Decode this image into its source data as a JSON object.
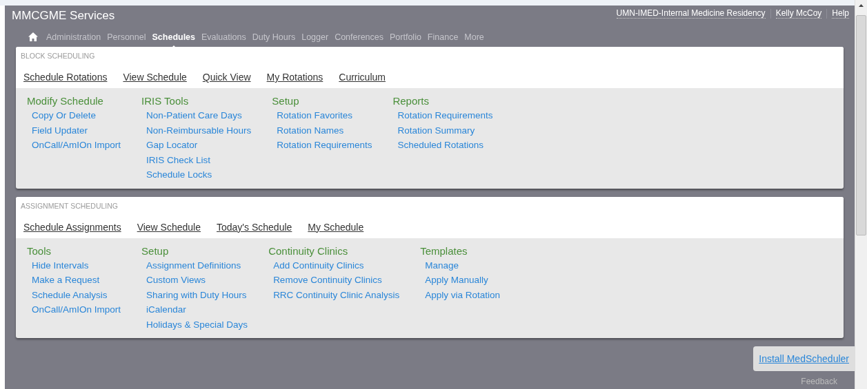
{
  "app_title": "MMCGME Services",
  "header_links": [
    "UMN-IMED-Internal Medicine Residency",
    "Kelly McCoy",
    "Help"
  ],
  "nav": [
    {
      "label": "Administration",
      "selected": false
    },
    {
      "label": "Personnel",
      "selected": false
    },
    {
      "label": "Schedules",
      "selected": true
    },
    {
      "label": "Evaluations",
      "selected": false
    },
    {
      "label": "Duty Hours",
      "selected": false
    },
    {
      "label": "Logger",
      "selected": false
    },
    {
      "label": "Conferences",
      "selected": false
    },
    {
      "label": "Portfolio",
      "selected": false
    },
    {
      "label": "Finance",
      "selected": false
    },
    {
      "label": "More",
      "selected": false
    }
  ],
  "sections": [
    {
      "title": "BLOCK SCHEDULING",
      "tabs": [
        "Schedule Rotations",
        "View Schedule",
        "Quick View",
        "My Rotations",
        "Curriculum"
      ],
      "groups": [
        {
          "heading": "Modify Schedule",
          "links": [
            "Copy Or Delete",
            "Field Updater",
            "OnCall/AmIOn Import"
          ]
        },
        {
          "heading": "IRIS Tools",
          "links": [
            "Non-Patient Care Days",
            "Non-Reimbursable Hours",
            "Gap Locator",
            "IRIS Check List",
            "Schedule Locks"
          ]
        },
        {
          "heading": "Setup",
          "links": [
            "Rotation Favorites",
            "Rotation Names",
            "Rotation Requirements"
          ]
        },
        {
          "heading": "Reports",
          "links": [
            "Rotation Requirements",
            "Rotation Summary",
            "Scheduled Rotations"
          ]
        }
      ]
    },
    {
      "title": "ASSIGNMENT SCHEDULING",
      "tabs": [
        "Schedule Assignments",
        "View Schedule",
        "Today's Schedule",
        "My Schedule"
      ],
      "groups": [
        {
          "heading": "Tools",
          "links": [
            "Hide Intervals",
            "Make a Request",
            "Schedule Analysis",
            "OnCall/AmIOn Import"
          ]
        },
        {
          "heading": "Setup",
          "links": [
            "Assignment Definitions",
            "Custom Views",
            "Sharing with Duty Hours",
            "iCalendar",
            "Holidays & Special Days"
          ]
        },
        {
          "heading": "Continuity Clinics",
          "links": [
            "Add Continuity Clinics",
            "Remove Continuity Clinics",
            "RRC Continuity Clinic Analysis"
          ]
        },
        {
          "heading": "Templates",
          "links": [
            "Manage",
            "Apply Manually",
            "Apply via Rotation"
          ]
        }
      ]
    }
  ],
  "install_link": "Install MedScheduler",
  "feedback": "Feedback"
}
